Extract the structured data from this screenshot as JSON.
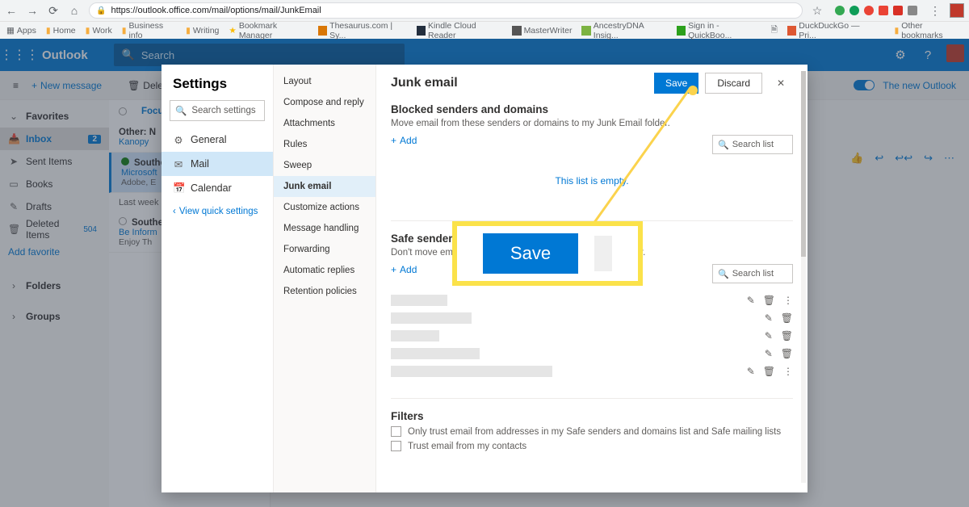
{
  "browser": {
    "url": "https://outlook.office.com/mail/options/mail/JunkEmail",
    "bookmarks": [
      "Apps",
      "Home",
      "Work",
      "Business info",
      "Writing",
      "Bookmark Manager",
      "Thesaurus.com | Sy...",
      "Kindle Cloud Reader",
      "MasterWriter",
      "AncestryDNA Insig...",
      "Sign in - QuickBoo...",
      "DuckDuckGo — Pri..."
    ],
    "other_bookmarks": "Other bookmarks"
  },
  "outlook": {
    "brand": "Outlook",
    "search_placeholder": "Search",
    "toolbar": {
      "new_message": "New message",
      "delete": "Delete",
      "new_outlook": "The new Outlook"
    },
    "nav": {
      "favorites": "Favorites",
      "inbox": "Inbox",
      "inbox_count": "2",
      "sent": "Sent Items",
      "books": "Books",
      "drafts": "Drafts",
      "deleted": "Deleted Items",
      "deleted_count": "504",
      "add_fav": "Add favorite",
      "folders": "Folders",
      "groups": "Groups"
    },
    "list": {
      "focused": "Focused",
      "other": "Other: N",
      "other_sub": "Kanopy",
      "item1_from": "Southern",
      "item1_sub": "Microsoft",
      "item1_prev": "Adobe, E",
      "last_week": "Last week",
      "item2_from": "Southern",
      "item2_sub": "Be Inform",
      "item2_prev": "Enjoy Th"
    }
  },
  "settings": {
    "title": "Settings",
    "search_placeholder": "Search settings",
    "col1": {
      "general": "General",
      "mail": "Mail",
      "calendar": "Calendar",
      "quick": "View quick settings"
    },
    "col2": [
      "Layout",
      "Compose and reply",
      "Attachments",
      "Rules",
      "Sweep",
      "Junk email",
      "Customize actions",
      "Message handling",
      "Forwarding",
      "Automatic replies",
      "Retention policies"
    ],
    "col2_selected": "Junk email",
    "junk": {
      "title": "Junk email",
      "save": "Save",
      "discard": "Discard",
      "blocked_title": "Blocked senders and domains",
      "blocked_desc": "Move email from these senders or domains to my Junk Email folder.",
      "add": "Add",
      "search_list": "Search list",
      "empty": "This list is empty.",
      "safe_title": "Safe senders and domains",
      "safe_desc": "Don't move email from these senders to my Junk Email folder.",
      "filters_title": "Filters",
      "filter1": "Only trust email from addresses in my Safe senders and domains list and Safe mailing lists",
      "filter2": "Trust email from my contacts"
    }
  },
  "callout": {
    "save": "Save"
  }
}
